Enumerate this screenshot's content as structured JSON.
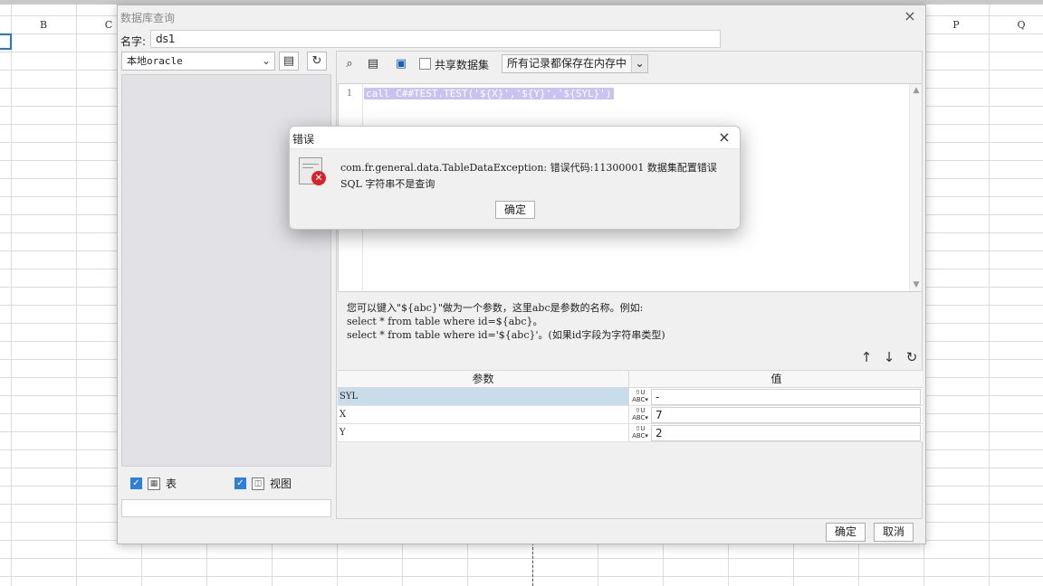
{
  "spreadsheet": {
    "columns": [
      {
        "key": "b",
        "label": "B"
      },
      {
        "key": "c",
        "label": "C"
      },
      {
        "key": "p",
        "label": "P"
      },
      {
        "key": "q",
        "label": "Q"
      }
    ]
  },
  "dialog": {
    "title": "数据库查询",
    "close_icon": "×",
    "name_label": "名字:",
    "name_value": "ds1",
    "datasource": "本地oracle",
    "table_label": "表",
    "view_label": "视图",
    "share_label": "共享数据集",
    "memory_option": "所有记录都保存在内存中",
    "sql": {
      "line_number": "1",
      "text": "call C##TEST.TEST('${X}','${Y}','${SYL}')"
    },
    "help": {
      "line1": "您可以键入\"${abc}\"做为一个参数，这里abc是参数的名称。例如:",
      "line2": "select * from table where id=${abc}。",
      "line3": "select * from table where id='${abc}'。(如果id字段为字符串类型)"
    },
    "params": {
      "header_name": "参数",
      "header_value": "值",
      "type_label": "ABC",
      "rows": [
        {
          "name": "SYL",
          "value": "-"
        },
        {
          "name": "X",
          "value": "7"
        },
        {
          "name": "Y",
          "value": "2"
        }
      ]
    },
    "ok_label": "确定",
    "cancel_label": "取消"
  },
  "error": {
    "title": "错误",
    "close_icon": "×",
    "message_line1": "com.fr.general.data.TableDataException: 错误代码:11300001 数据集配置错误",
    "message_line2": "SQL 字符串不是查询",
    "ok_label": "确定"
  },
  "colors": {
    "selection": "#c7c4f2",
    "selected_row": "#c9dcea",
    "accent": "#2f7fd8",
    "error": "#d6222a"
  }
}
